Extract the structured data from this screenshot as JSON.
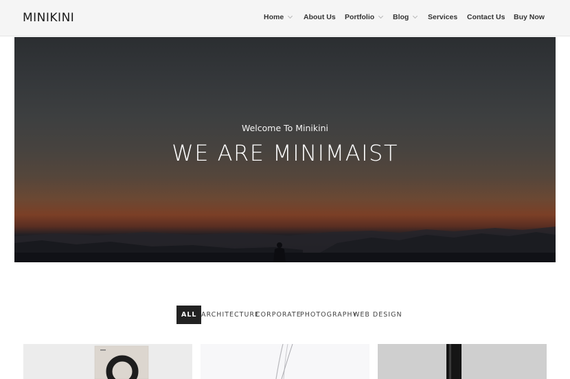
{
  "site": {
    "logo": "MINIKINI"
  },
  "nav": {
    "items": [
      {
        "label": "Home",
        "has_dropdown": true
      },
      {
        "label": "About Us",
        "has_dropdown": false
      },
      {
        "label": "Portfolio",
        "has_dropdown": true
      },
      {
        "label": "Blog",
        "has_dropdown": true
      },
      {
        "label": "Services",
        "has_dropdown": false
      },
      {
        "label": "Contact Us",
        "has_dropdown": false
      },
      {
        "label": "Buy Now",
        "has_dropdown": false
      }
    ]
  },
  "hero": {
    "subtitle": "Welcome To Minikini",
    "title": "WE ARE MINIMAIST"
  },
  "filters": {
    "items": [
      "ALL",
      "ARCHITECTURE",
      "CORPORATE",
      "PHOTOGRAPHY",
      "WEB DESIGN"
    ],
    "active": "ALL"
  },
  "portfolio": {
    "items": [
      {
        "name": "portfolio-item-1"
      },
      {
        "name": "portfolio-item-2"
      },
      {
        "name": "portfolio-item-3"
      }
    ]
  },
  "colors": {
    "header_bg": "#f5f5f5",
    "active_filter_bg": "#222222",
    "text": "#333333"
  }
}
